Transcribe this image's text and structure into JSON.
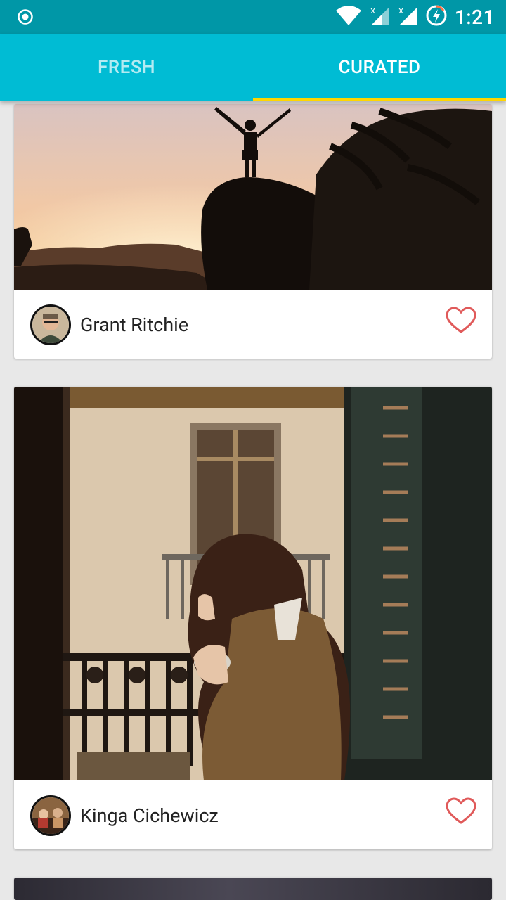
{
  "status_bar": {
    "time": "1:21"
  },
  "tabs": [
    {
      "label": "FRESH",
      "selected": false
    },
    {
      "label": "CURATED",
      "selected": true
    }
  ],
  "colors": {
    "status_bar": "#0097a7",
    "app_bar": "#00bcd4",
    "indicator": "#ffd600",
    "heart": "#e05a5a"
  },
  "feed": [
    {
      "author": "Grant Ritchie",
      "image": "silhouette-person-on-rock-at-sunset",
      "liked": false
    },
    {
      "author": "Kinga Cichewicz",
      "image": "woman-drinking-coffee-on-balcony",
      "liked": false
    },
    {
      "author": "",
      "image": "dark-photo-partially-visible",
      "liked": false
    }
  ],
  "icons": {
    "status_left": "radio-button-icon",
    "wifi": "wifi-icon",
    "signal": "signal-icon",
    "battery": "battery-charging-icon",
    "like": "heart-outline-icon"
  }
}
